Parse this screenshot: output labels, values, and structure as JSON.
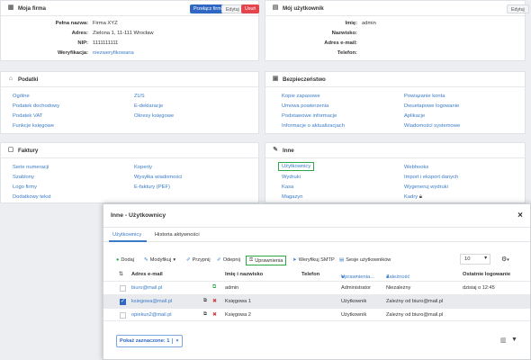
{
  "firma": {
    "title": "Moja firma",
    "btn_switch": "Przełącz firmę",
    "btn_edit": "Edytuj",
    "btn_delete": "Usuń",
    "rows": [
      {
        "label": "Pełna nazwa:",
        "value": "Firma XYZ"
      },
      {
        "label": "Adres:",
        "value": "Zielona 1, 11-111 Wrocław"
      },
      {
        "label": "NIP:",
        "value": "1111111111"
      },
      {
        "label": "Weryfikacja:",
        "value": "niezweryfikowana"
      }
    ]
  },
  "uzytkownik": {
    "title": "Mój użytkownik",
    "btn_edit": "Edytuj",
    "rows": [
      {
        "label": "Imię:",
        "value": "admin"
      },
      {
        "label": "Nazwisko:",
        "value": ""
      },
      {
        "label": "Adres e-mail:",
        "value": ""
      },
      {
        "label": "Telefon:",
        "value": ""
      }
    ]
  },
  "podatki": {
    "title": "Podatki",
    "col1": [
      "Ogólne",
      "Podatek dochodowy",
      "Podatek VAT",
      "Funkcje księgowe"
    ],
    "col2": [
      "ZUS",
      "E-deklaracje",
      "Okresy księgowe"
    ]
  },
  "bezpieczenstwo": {
    "title": "Bezpieczeństwo",
    "col1": [
      "Kopie zapasowe",
      "Umowa powierzenia",
      "Podstawowe informacje",
      "Informacje o aktualizacjach"
    ],
    "col2": [
      "Powiązanie konta",
      "Dwuetapowe logowanie",
      "Aplikacje",
      "Wiadomości systemowe"
    ]
  },
  "faktury": {
    "title": "Faktury",
    "col1": [
      "Serie numeracji",
      "Szablony",
      "Logo firmy",
      "Dodatkowy tekst"
    ],
    "col2": [
      "Koperty",
      "Wysyłka wiadomości",
      "E-faktury (PEF)"
    ]
  },
  "inne": {
    "title": "Inne",
    "col1": [
      "Użytkownicy",
      "Wydruki",
      "Kasa",
      "Magazyn"
    ],
    "col2": [
      "Webhooks",
      "Import i eksport danych",
      "Wygeneruj wydruki",
      "Kadry"
    ]
  },
  "modal": {
    "title": "Inne - Użytkownicy",
    "close": "×",
    "tabs": [
      "Użytkownicy",
      "Historia aktywności"
    ],
    "toolbar": {
      "add": "Dodaj",
      "modify": "Modyfikuj",
      "assign": "Przypnij",
      "unassign": "Odepnij",
      "permissions": "Uprawnienia",
      "verify_smtp": "Weryfikuj SMTP",
      "sessions": "Sesje użytkowników",
      "page_size": "10"
    },
    "headers": [
      "Adres e-mail",
      "Imię i nazwisko",
      "Telefon",
      "Uprawnienia...",
      "Zależność",
      "Ostatnie logowanie"
    ],
    "rows": [
      {
        "email": "biuro@mail.pl",
        "name": "admin",
        "phone": "",
        "role": "Administrator",
        "dep": "Niezależny",
        "last": "dzisiaj o 12:45",
        "checked": false
      },
      {
        "email": "ksiegowa@mail.pl",
        "name": "Księgowa 1",
        "phone": "",
        "role": "Użytkownik",
        "dep": "Zależny od biuro@mail.pl",
        "last": "",
        "checked": true
      },
      {
        "email": "opiekun2@mail.pl",
        "name": "Księgowa 2",
        "phone": "",
        "role": "Użytkownik",
        "dep": "Zależny od biuro@mail.pl",
        "last": "",
        "checked": false
      }
    ],
    "selection_label": "Pokaż zaznaczone: 1",
    "selection_clear": "×"
  },
  "colors": {
    "accent": "#3a7bc8",
    "highlight": "#2ca84a",
    "danger": "#e4444c"
  }
}
